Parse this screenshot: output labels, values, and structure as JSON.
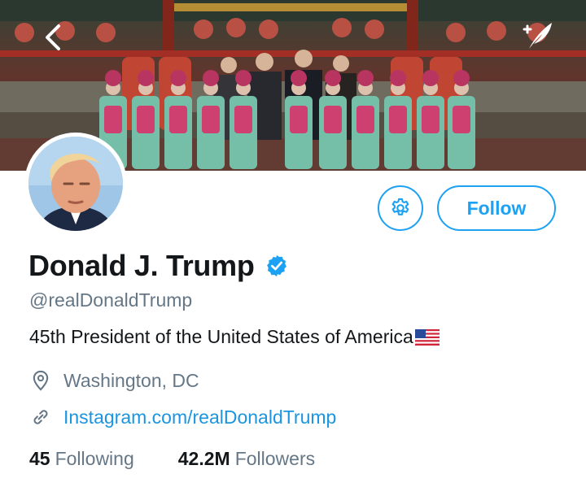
{
  "profile": {
    "name": "Donald J. Trump",
    "handle": "@realDonaldTrump",
    "bio": "45th President of the United States of America",
    "location": "Washington, DC",
    "website": "Instagram.com/realDonaldTrump",
    "following_count": "45",
    "following_label": "Following",
    "followers_count": "42.2M",
    "followers_label": "Followers",
    "verified": true
  },
  "actions": {
    "follow_label": "Follow"
  },
  "icons": {
    "back": "chevron-left-icon",
    "compose": "compose-tweet-icon",
    "settings": "gear-icon",
    "verified": "verified-badge-icon",
    "location": "location-pin-icon",
    "link": "link-icon",
    "flag": "us-flag-emoji"
  },
  "colors": {
    "accent": "#1da1f2",
    "link": "#1b95e0",
    "text": "#14171a",
    "secondary": "#657786"
  }
}
